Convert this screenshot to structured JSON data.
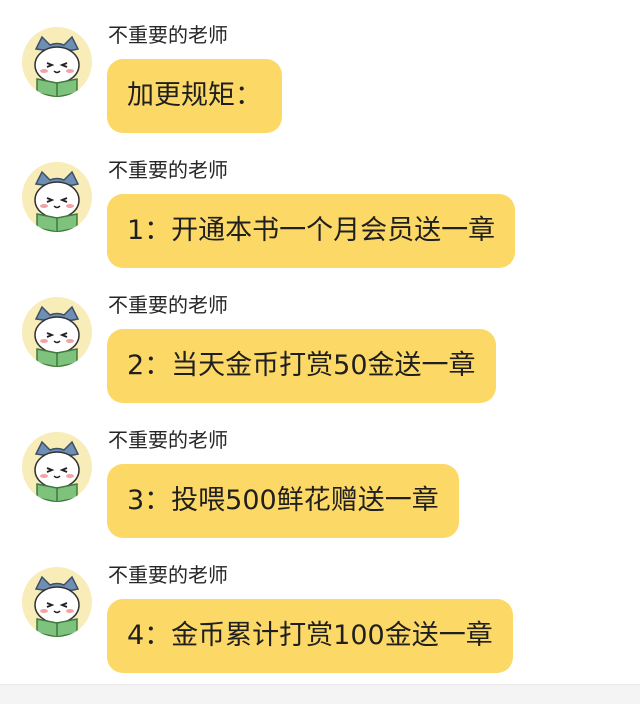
{
  "messages": [
    {
      "sender": "不重要的老师",
      "text": "加更规矩：",
      "avatar": "cat-reading-icon"
    },
    {
      "sender": "不重要的老师",
      "text": "1：开通本书一个月会员送一章",
      "avatar": "cat-reading-icon"
    },
    {
      "sender": "不重要的老师",
      "text": "2：当天金币打赏50金送一章",
      "avatar": "cat-reading-icon"
    },
    {
      "sender": "不重要的老师",
      "text": "3：投喂500鲜花赠送一章",
      "avatar": "cat-reading-icon"
    },
    {
      "sender": "不重要的老师",
      "text": "4：金币累计打赏100金送一章",
      "avatar": "cat-reading-icon"
    }
  ],
  "colors": {
    "bubble": "#fcd966",
    "avatar_bg": "#f8ecb8",
    "cat_hat": "#6e8fb3",
    "book": "#7ec27e"
  }
}
